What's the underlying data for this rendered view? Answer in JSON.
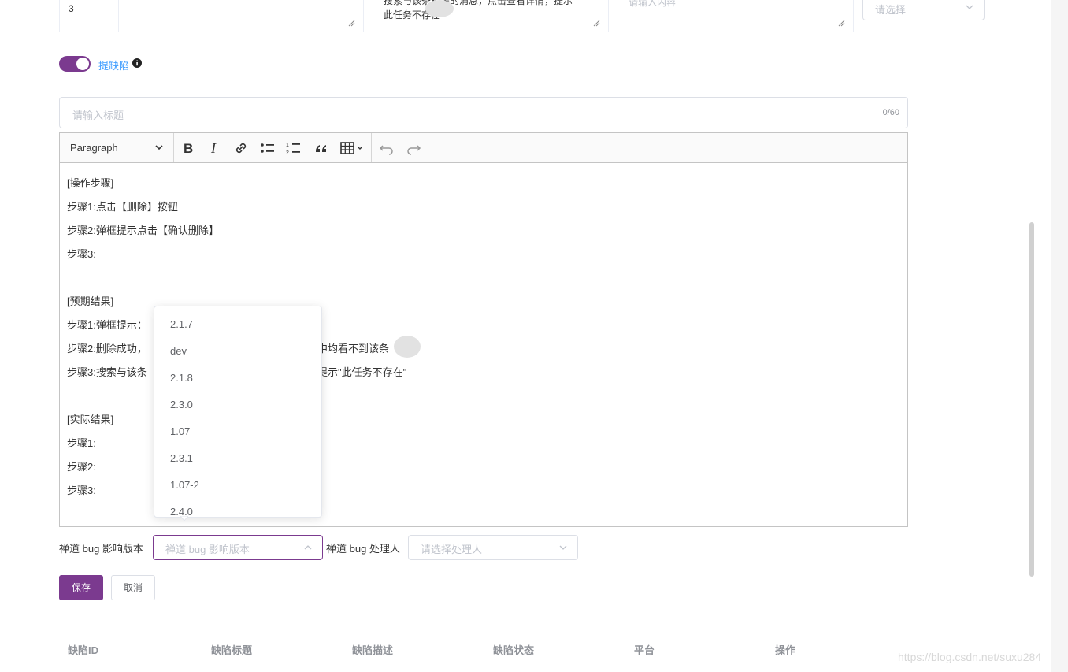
{
  "top_row": {
    "row_number": "3",
    "expected_text": "搜索与该条相关的消息，点击查看详情，提示” 此任务不存在 “",
    "actual_placeholder": "请输入内容",
    "select_placeholder": "请选择"
  },
  "defect_toggle": {
    "label": "提缺陷",
    "on": true
  },
  "title_input": {
    "placeholder": "请输入标题",
    "counter": "0/60"
  },
  "editor": {
    "paragraph_label": "Paragraph",
    "toolbar_icons": [
      "bold-icon",
      "italic-icon",
      "link-icon",
      "bulleted-list-icon",
      "numbered-list-icon",
      "block-quote-icon",
      "table-icon",
      "undo-icon",
      "redo-icon"
    ],
    "lines": [
      "[操作步骤]",
      "步骤1:点击【删除】按钮",
      "步骤2:弹框提示点击【确认删除】",
      "步骤3:",
      "",
      "[预期结果]",
      "步骤1:弹框提示：",
      "步骤2:删除成功，",
      "步骤3:搜索与该条",
      "",
      "[实际结果]",
      "步骤1:",
      "步骤2:",
      "步骤3:"
    ],
    "partial_line_7_tail": "中均看不到该条",
    "partial_line_8_tail": "提示\"此任务不存在\""
  },
  "version_dropdown": {
    "options": [
      "2.1.7",
      "dev",
      "2.1.8",
      "2.3.0",
      "1.07",
      "2.3.1",
      "1.07-2",
      "2.4.0"
    ]
  },
  "form": {
    "version_label": "禅道 bug 影响版本",
    "version_placeholder": "禅道 bug 影响版本",
    "handler_label": "禅道 bug 处理人",
    "handler_placeholder": "请选择处理人",
    "save_label": "保存",
    "cancel_label": "取消"
  },
  "defect_table": {
    "columns": [
      "缺陷ID",
      "缺陷标题",
      "缺陷描述",
      "缺陷状态",
      "平台",
      "操作"
    ]
  },
  "watermark": "https://blog.csdn.net/suxu284",
  "colors": {
    "accent": "#7b3a8f",
    "link": "#409eff",
    "placeholder": "#c0c4cc"
  }
}
